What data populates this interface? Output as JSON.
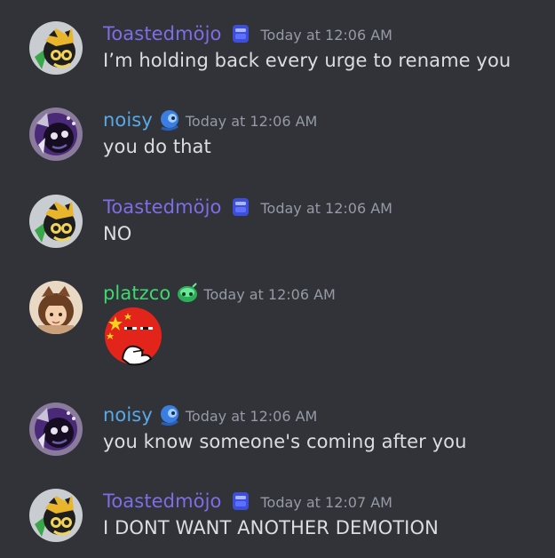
{
  "colors": {
    "background": "#313338",
    "text": "#dbdee1",
    "timestamp": "#949ba4",
    "toastedmojo_name": "#7c6ee6",
    "noisy_name": "#58a9e6",
    "platzco_name": "#3ed870"
  },
  "messages": [
    {
      "username": "Toastedmöjo",
      "role_icon": "toast-badge-icon",
      "timestamp": "Today at 12:06 AM",
      "content": "I’m holding back every urge to rename you"
    },
    {
      "username": "noisy",
      "role_icon": "blue-mascot-badge-icon",
      "timestamp": "Today at 12:06 AM",
      "content": "you do that"
    },
    {
      "username": "Toastedmöjo",
      "role_icon": "toast-badge-icon",
      "timestamp": "Today at 12:06 AM",
      "content": "NO"
    },
    {
      "username": "platzco",
      "role_icon": "green-slime-badge-icon",
      "timestamp": "Today at 12:06 AM",
      "content_emoji": "chinaball-thinking-emoji"
    },
    {
      "username": "noisy",
      "role_icon": "blue-mascot-badge-icon",
      "timestamp": "Today at 12:06 AM",
      "content": "you know someone's coming after you"
    },
    {
      "username": "Toastedmöjo",
      "role_icon": "toast-badge-icon",
      "timestamp": "Today at 12:07 AM",
      "content": "I DONT WANT ANOTHER DEMOTION"
    }
  ]
}
